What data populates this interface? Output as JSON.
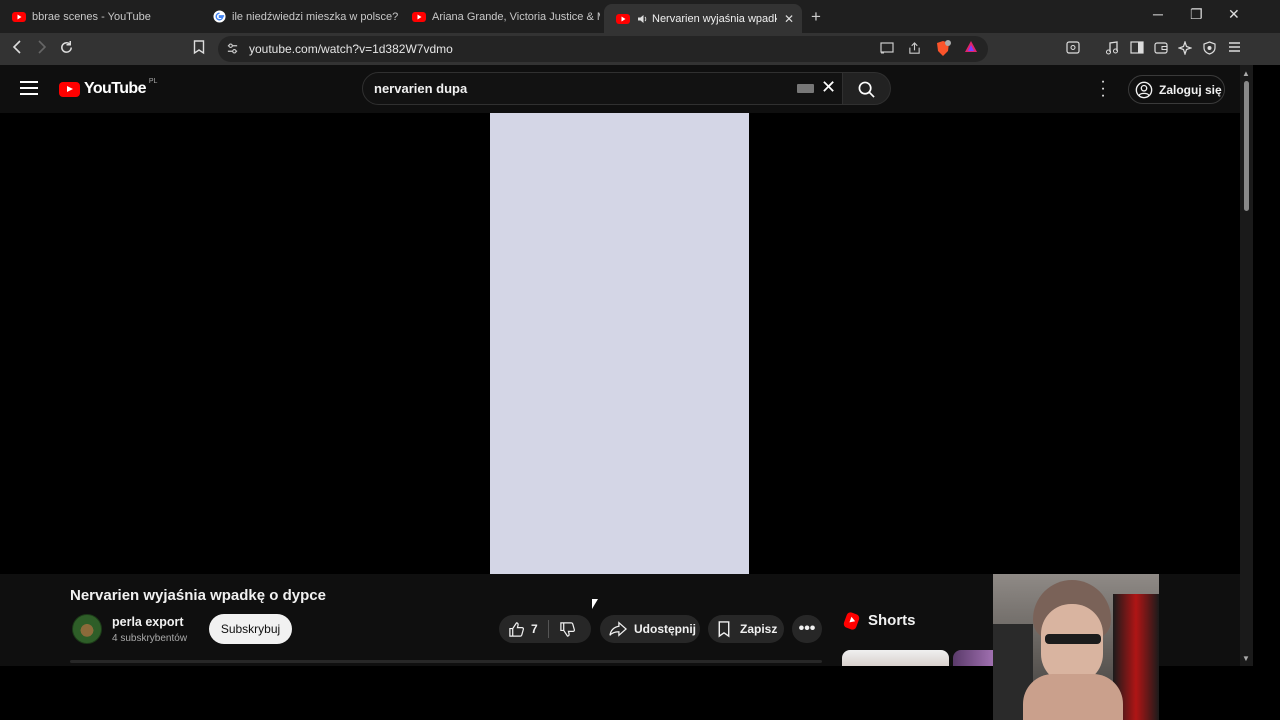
{
  "browser": {
    "tabs": [
      {
        "title": "bbrae scenes - YouTube",
        "icon": "youtube-favicon"
      },
      {
        "title": "ile niedźwiedzi mieszka w polsce? - S",
        "icon": "google-favicon"
      },
      {
        "title": "Ariana Grande, Victoria Justice & Mo",
        "icon": "youtube-favicon"
      },
      {
        "title": "Nervarien wyjaśnia wpadkę o",
        "icon": "youtube-favicon",
        "active": true,
        "audio": true
      }
    ],
    "url": "youtube.com/watch?v=1d382W7vdmo"
  },
  "youtube": {
    "logo_text": "YouTube",
    "country_code": "PL",
    "search_query": "nervarien dupa",
    "signin_label": "Zaloguj się"
  },
  "video": {
    "title": "Nervarien wyjaśnia wpadkę o dypce",
    "channel_name": "perla export",
    "subscribers": "4 subskrybentów",
    "subscribe_label": "Subskrybuj",
    "likes": "7",
    "share_label": "Udostępnij",
    "save_label": "Zapisz"
  },
  "sidebar": {
    "shorts_label": "Shorts"
  },
  "colors": {
    "youtube_red": "#ff0000",
    "background": "#0f0f0f",
    "video_frame": "#d4d6e6"
  }
}
